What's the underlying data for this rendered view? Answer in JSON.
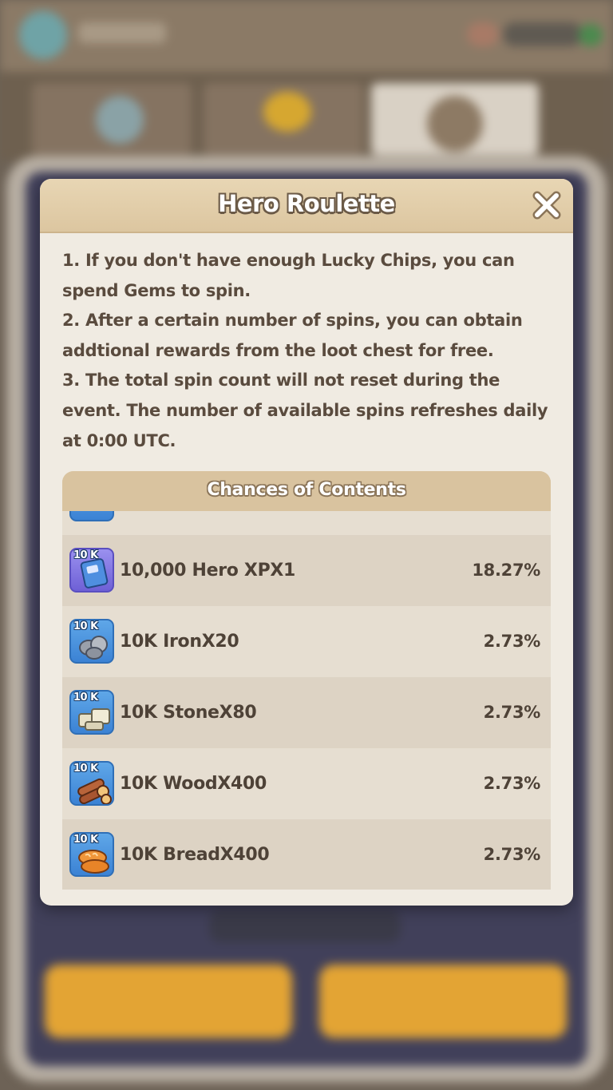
{
  "dialog": {
    "title": "Hero Roulette",
    "close_icon": "close-icon",
    "description": [
      "1. If you don't have enough Lucky Chips, you can spend Gems to spin.",
      "2. After a certain number of spins, you can obtain addtional rewards from the loot chest for free.",
      "3. The total spin count will not reset during the event. The number of available spins refreshes daily at 0:00 UTC."
    ]
  },
  "chances": {
    "title": "Chances of Contents",
    "items": [
      {
        "badge": "10 K",
        "name": "10,000 Hero XPX1",
        "chance": "18.27%",
        "icon": "hero-xp-book-icon",
        "color": "#8a7ee0"
      },
      {
        "badge": "10 K",
        "name": "10K IronX20",
        "chance": "2.73%",
        "icon": "iron-ore-icon",
        "color": "#4f8fd8"
      },
      {
        "badge": "10 K",
        "name": "10K StoneX80",
        "chance": "2.73%",
        "icon": "stone-icon",
        "color": "#4f8fd8"
      },
      {
        "badge": "10 K",
        "name": "10K WoodX400",
        "chance": "2.73%",
        "icon": "wood-logs-icon",
        "color": "#4f8fd8"
      },
      {
        "badge": "10 K",
        "name": "10K BreadX400",
        "chance": "2.73%",
        "icon": "bread-icon",
        "color": "#4f8fd8"
      }
    ]
  }
}
